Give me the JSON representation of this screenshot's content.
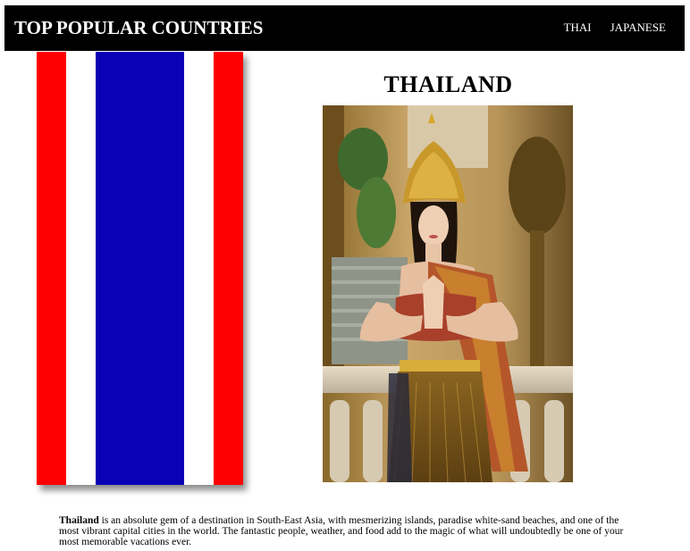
{
  "header": {
    "title": "TOP POPULAR COUNTRIES",
    "nav": [
      {
        "label": "THAI"
      },
      {
        "label": "JAPANESE"
      }
    ]
  },
  "flag": {
    "colors": [
      "#ff0000",
      "#ffffff",
      "#0a00b5",
      "#ffffff",
      "#ff0000"
    ],
    "icon": "thailand-flag"
  },
  "country": {
    "title": "THAILAND",
    "photo_icon": "thai-dancer-photo",
    "description_lead": "Thailand",
    "description_rest": " is an absolute gem of a destination in South-East Asia, with mesmerizing islands, paradise white-sand beaches, and one of the most vibrant capital cities in the world. The fantastic people, weather, and food add to the magic of what will undoubtedly be one of your most memorable vacations ever."
  }
}
